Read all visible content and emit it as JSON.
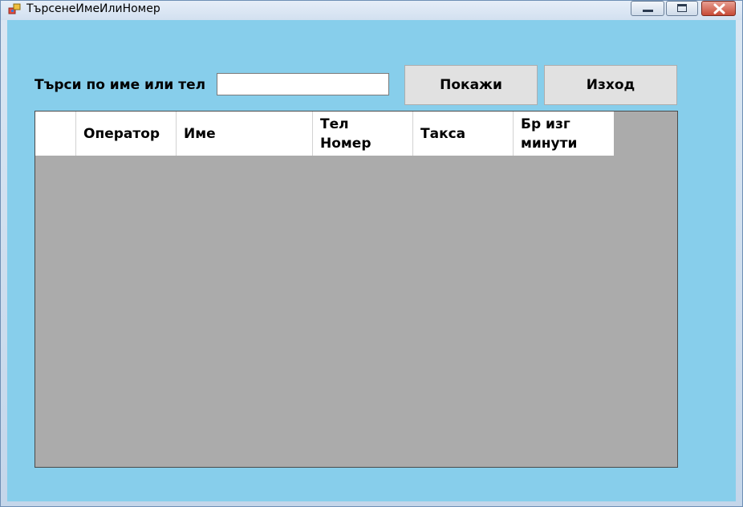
{
  "window": {
    "title": "ТърсенеИмеИлиНомер",
    "icon": "app-form-icon"
  },
  "search": {
    "label": "Търси по име или тел",
    "value": "",
    "placeholder": ""
  },
  "buttons": {
    "show": "Покажи",
    "exit": "Изход"
  },
  "grid": {
    "columns": [
      "Оператор",
      "Име",
      "Тел\nНомер",
      "Такса",
      "Бр изг\nминути"
    ],
    "rows": []
  },
  "colors": {
    "client_background": "#87ceeb",
    "grid_background": "#ababab"
  }
}
